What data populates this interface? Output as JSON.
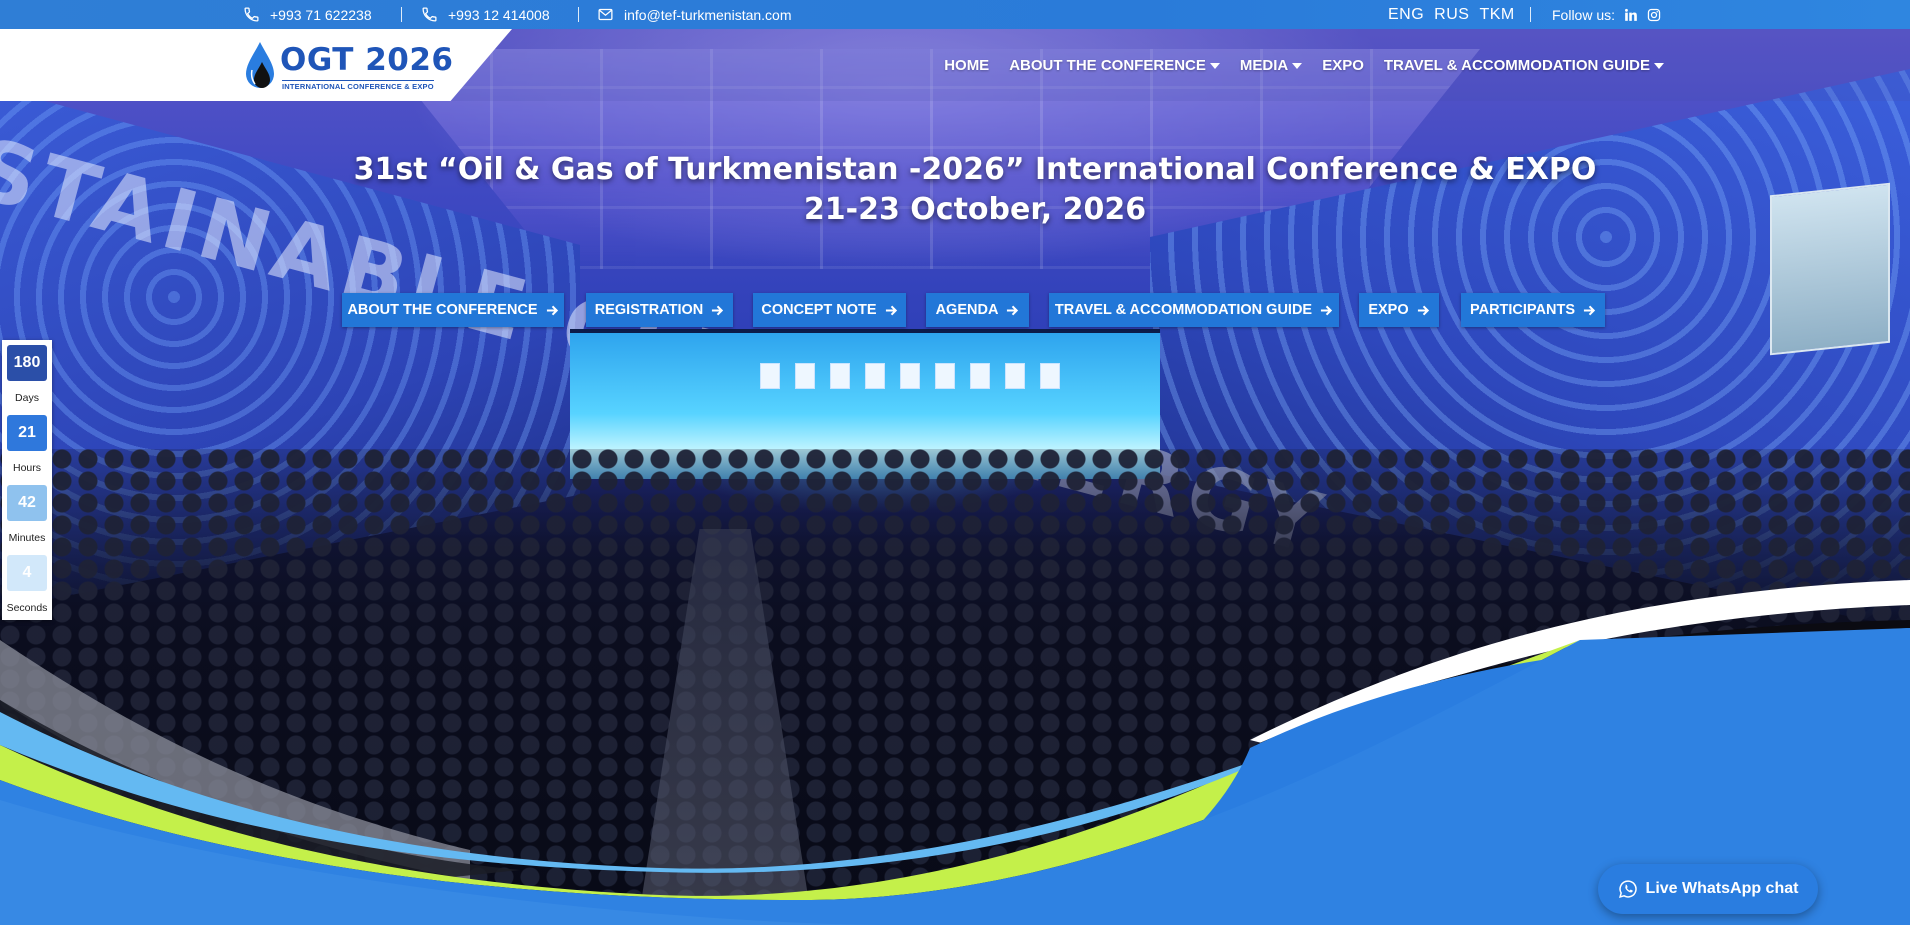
{
  "topbar": {
    "phone1": "+993 71 622238",
    "phone2": "+993 12 414008",
    "email": "info@tef-turkmenistan.com",
    "languages": [
      "ENG",
      "RUS",
      "TKM"
    ],
    "follow_label": "Follow us:",
    "icons": {
      "phone": "phone-icon",
      "email": "envelope-icon",
      "linkedin": "linkedin-icon",
      "instagram": "instagram-icon"
    }
  },
  "logo": {
    "title": "OGT 2026",
    "subtitle": "INTERNATIONAL CONFERENCE & EXPO"
  },
  "nav": [
    {
      "label": "HOME",
      "dropdown": false
    },
    {
      "label": "ABOUT THE CONFERENCE",
      "dropdown": true
    },
    {
      "label": "MEDIA",
      "dropdown": true
    },
    {
      "label": "EXPO",
      "dropdown": false
    },
    {
      "label": "TRAVEL & ACCOMMODATION GUIDE",
      "dropdown": true
    }
  ],
  "hero": {
    "title": "31st “Oil & Gas of Turkmenistan -2026” International Conference & EXPO",
    "date": "21-23 October, 2026",
    "backdrop_text": "STAINABLE CLEAN ENERGY"
  },
  "quick_buttons": [
    "ABOUT THE CONFERENCE",
    "REGISTRATION",
    "CONCEPT NOTE",
    "AGENDA",
    "TRAVEL & ACCOMMODATION GUIDE",
    "EXPO",
    "PARTICIPANTS"
  ],
  "countdown": {
    "days": {
      "value": "180",
      "label": "Days"
    },
    "hours": {
      "value": "21",
      "label": "Hours"
    },
    "minutes": {
      "value": "42",
      "label": "Minutes"
    },
    "seconds": {
      "value": "4",
      "label": "Seconds"
    }
  },
  "whatsapp": {
    "label": "Live WhatsApp chat",
    "icon": "whatsapp-icon"
  },
  "colors": {
    "brand_blue": "#2277d8",
    "topbar_blue": "#2f7ed6",
    "lime_wave": "#c4f04a",
    "light_blue_wave": "#64b9f2",
    "logo_blue": "#1f55b8"
  }
}
